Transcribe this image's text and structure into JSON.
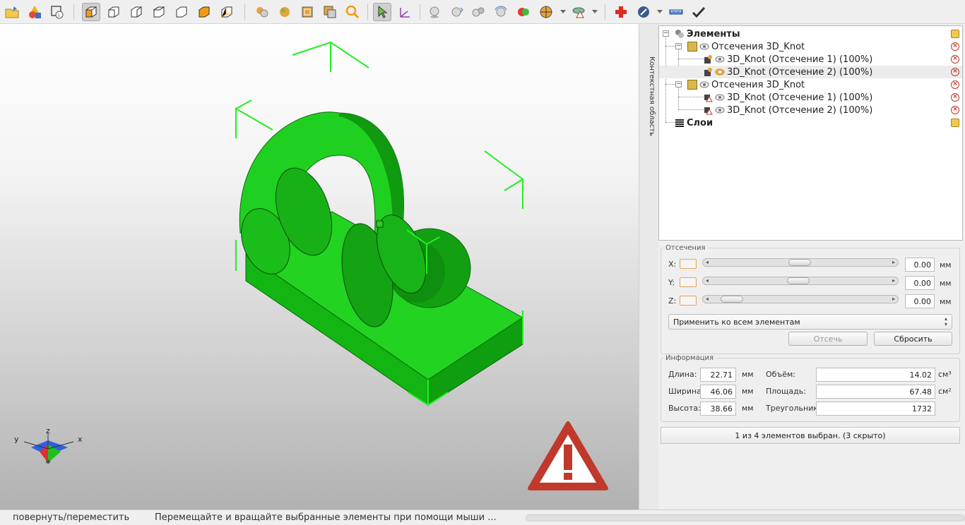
{
  "toolbar": {
    "icons": [
      "open-folder-icon",
      "add-shapes-icon",
      "info-icon",
      "cube-iso-icon",
      "cube-front-icon",
      "cube-right-icon",
      "cube-top-icon",
      "cube-left-icon",
      "cube-bottom-icon",
      "cube-back-icon",
      "spheres-icon",
      "sphere-group-icon",
      "cube-frame-icon",
      "cube-copy-icon",
      "zoom-icon",
      "select-arrow-icon",
      "axes-move-icon",
      "sphere-icon",
      "sphere-arrow-icon",
      "spheres-pair-icon",
      "sphere-rotate-icon",
      "red-green-spheres-icon",
      "beach-ball-icon",
      "layers-warning-icon",
      "red-cross-icon",
      "mirror-icon",
      "ruler-icon",
      "checkmark-icon"
    ]
  },
  "viewport": {
    "axes": {
      "x": "x",
      "y": "y",
      "z": "z"
    }
  },
  "side_tab": "Контекстная область",
  "tree": {
    "root": "Элементы",
    "groups": [
      {
        "label": "Отсечения 3D_Knot",
        "children": [
          "3D_Knot (Отсечение 1) (100%)",
          "3D_Knot (Отсечение 2) (100%)"
        ]
      },
      {
        "label": "Отсечения 3D_Knot",
        "children": [
          "3D_Knot (Отсечение 1) (100%)",
          "3D_Knot (Отсечение 2) (100%)"
        ]
      }
    ],
    "layers": "Слои"
  },
  "cuts": {
    "title": "Отсечения",
    "x_label": "X:",
    "y_label": "Y:",
    "z_label": "Z:",
    "x_value": "0.00",
    "y_value": "0.00",
    "z_value": "0.00",
    "unit": "мм",
    "x_level": 0.5,
    "y_level": 0.49,
    "z_level": 0.05,
    "apply_option": "Применить ко всем элементам",
    "cut_button": "Отсечь",
    "reset_button": "Сбросить"
  },
  "info": {
    "title": "Информация",
    "length_label": "Длина:",
    "length_value": "22.71",
    "width_label": "Ширина:",
    "width_value": "46.06",
    "height_label": "Высота:",
    "height_value": "38.66",
    "mm": "мм",
    "volume_label": "Объём:",
    "volume_value": "14.02",
    "volume_unit": "см³",
    "area_label": "Площадь:",
    "area_value": "67.48",
    "area_unit": "см²",
    "triangles_label": "Треугольники",
    "triangles_value": "1732"
  },
  "selection_status": "1 из 4 элементов выбран. (3 скрыто)",
  "status": {
    "mode": "повернуть/переместить",
    "hint": "Перемещайте и вращайте выбранные элементы при помощи мыши ..."
  }
}
